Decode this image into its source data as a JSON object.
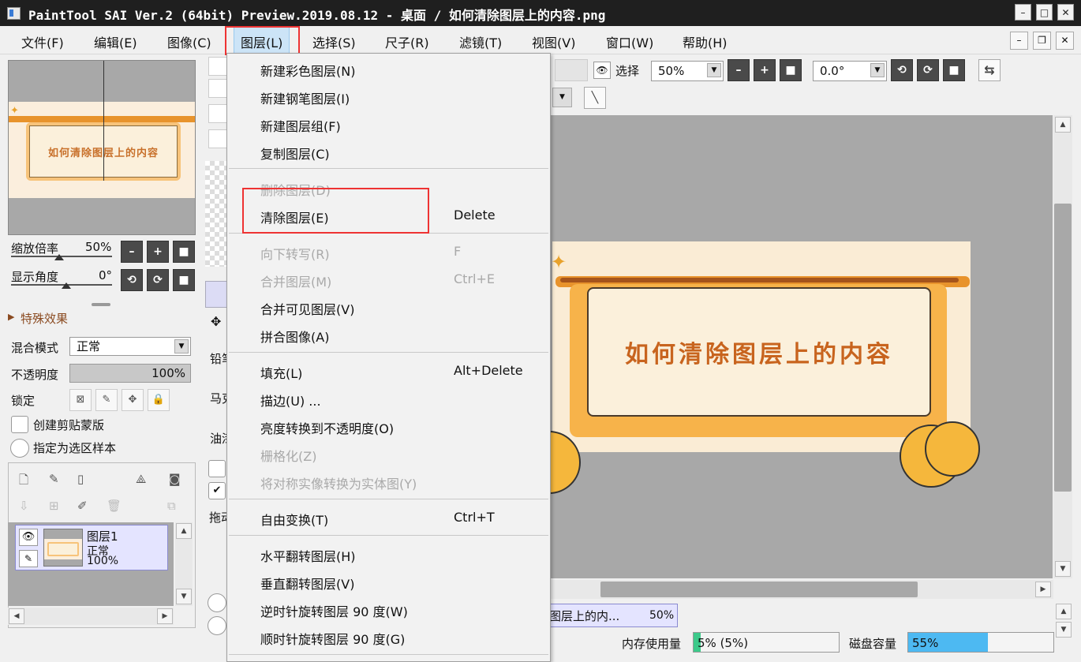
{
  "window": {
    "title": "PaintTool SAI Ver.2 (64bit) Preview.2019.08.12 - 桌面 / 如何清除图层上的内容.png",
    "minimize": "–",
    "maximize": "□",
    "close": "✕"
  },
  "menubar": {
    "items": [
      {
        "label": "文件(F)"
      },
      {
        "label": "编辑(E)"
      },
      {
        "label": "图像(C)"
      },
      {
        "label": "图层(L)"
      },
      {
        "label": "选择(S)"
      },
      {
        "label": "尺子(R)"
      },
      {
        "label": "滤镜(T)"
      },
      {
        "label": "视图(V)"
      },
      {
        "label": "窗口(W)"
      },
      {
        "label": "帮助(H)"
      }
    ]
  },
  "navigator": {
    "preview_text": "如何清除图层上的内容",
    "zoom_label": "缩放倍率",
    "zoom_value": "50%",
    "angle_label": "显示角度",
    "angle_value": "0°",
    "zoom_progress": 0.5,
    "angle_progress": 0.5
  },
  "effects": {
    "label": "特殊效果"
  },
  "layer_props": {
    "blend_label": "混合模式",
    "blend_value": "正常",
    "opacity_label": "不透明度",
    "opacity_value": "100%",
    "lock_label": "锁定",
    "clip_label": "创建剪贴蒙版",
    "sample_label": "指定为选区样本"
  },
  "layers": [
    {
      "name": "图层1",
      "mode": "正常",
      "opacity": "100%"
    }
  ],
  "tools_partial": {
    "pencil": "铅笔",
    "marker": "马克",
    "oil": "油漆",
    "drag": "拖动"
  },
  "toolbar": {
    "select_label": "选择",
    "zoom_value": "50%",
    "angle_value": "0.0°"
  },
  "canvas": {
    "banner_text": "如何清除图层上的内容"
  },
  "doc_tab": {
    "name": "图层上的内...",
    "zoom": "50%"
  },
  "status": {
    "memory_label": "内存使用量",
    "memory_value": "5% (5%)",
    "memory_fraction": 0.05,
    "disk_label": "磁盘容量",
    "disk_value": "55%",
    "disk_fraction": 0.55
  },
  "layer_menu": {
    "items": [
      {
        "label": "新建彩色图层(N)",
        "shortcut": "",
        "enabled": true
      },
      {
        "label": "新建钢笔图层(I)",
        "shortcut": "",
        "enabled": true
      },
      {
        "label": "新建图层组(F)",
        "shortcut": "",
        "enabled": true
      },
      {
        "label": "复制图层(C)",
        "shortcut": "",
        "enabled": true
      },
      {
        "label": "删除图层(D)",
        "shortcut": "",
        "enabled": false
      },
      {
        "label": "清除图层(E)",
        "shortcut": "Delete",
        "enabled": true
      },
      {
        "label": "向下转写(R)",
        "shortcut": "F",
        "enabled": false
      },
      {
        "label": "合并图层(M)",
        "shortcut": "Ctrl+E",
        "enabled": false
      },
      {
        "label": "合并可见图层(V)",
        "shortcut": "",
        "enabled": true
      },
      {
        "label": "拼合图像(A)",
        "shortcut": "",
        "enabled": true
      },
      {
        "label": "填充(L)",
        "shortcut": "Alt+Delete",
        "enabled": true
      },
      {
        "label": "描边(U) ...",
        "shortcut": "",
        "enabled": true
      },
      {
        "label": "亮度转换到不透明度(O)",
        "shortcut": "",
        "enabled": true
      },
      {
        "label": "栅格化(Z)",
        "shortcut": "",
        "enabled": false
      },
      {
        "label": "将对称实像转换为实体图(Y)",
        "shortcut": "",
        "enabled": false
      },
      {
        "label": "自由变换(T)",
        "shortcut": "Ctrl+T",
        "enabled": true
      },
      {
        "label": "水平翻转图层(H)",
        "shortcut": "",
        "enabled": true
      },
      {
        "label": "垂直翻转图层(V)",
        "shortcut": "",
        "enabled": true
      },
      {
        "label": "逆时针旋转图层 90 度(W)",
        "shortcut": "",
        "enabled": true
      },
      {
        "label": "顺时针旋转图层 90 度(G)",
        "shortcut": "",
        "enabled": true
      }
    ]
  },
  "colors": {
    "highlight": "#e33333",
    "menu_active": "#cce4f7",
    "banner_orange": "#c8641e",
    "disk_fill": "#4db9f2",
    "memory_fill": "#3cc98a"
  }
}
